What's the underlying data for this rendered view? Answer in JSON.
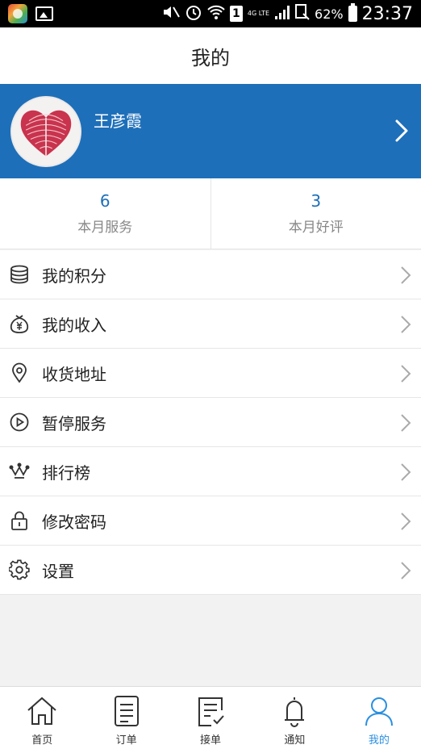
{
  "status_bar": {
    "battery_percent": "62%",
    "time": "23:37",
    "network": "4G LTE",
    "sim_slot": "1"
  },
  "header": {
    "title": "我的"
  },
  "profile": {
    "name": "王彦霞"
  },
  "stats": [
    {
      "value": "6",
      "label": "本月服务"
    },
    {
      "value": "3",
      "label": "本月好评"
    }
  ],
  "menu": [
    {
      "label": "我的积分",
      "icon": "coins-stack-icon"
    },
    {
      "label": "我的收入",
      "icon": "money-bag-icon"
    },
    {
      "label": "收货地址",
      "icon": "location-pin-icon"
    },
    {
      "label": "暂停服务",
      "icon": "play-circle-icon"
    },
    {
      "label": "排行榜",
      "icon": "crown-icon"
    },
    {
      "label": "修改密码",
      "icon": "lock-icon"
    },
    {
      "label": "设置",
      "icon": "gear-icon"
    }
  ],
  "tabs": [
    {
      "label": "首页",
      "icon": "home-icon",
      "active": false
    },
    {
      "label": "订单",
      "icon": "order-list-icon",
      "active": false
    },
    {
      "label": "接单",
      "icon": "accept-order-icon",
      "active": false
    },
    {
      "label": "通知",
      "icon": "bell-icon",
      "active": false
    },
    {
      "label": "我的",
      "icon": "person-icon",
      "active": true
    }
  ],
  "colors": {
    "brand_blue": "#1e6fb9",
    "active_tab": "#2a8fe0",
    "stat_value": "#1e6fb9"
  }
}
